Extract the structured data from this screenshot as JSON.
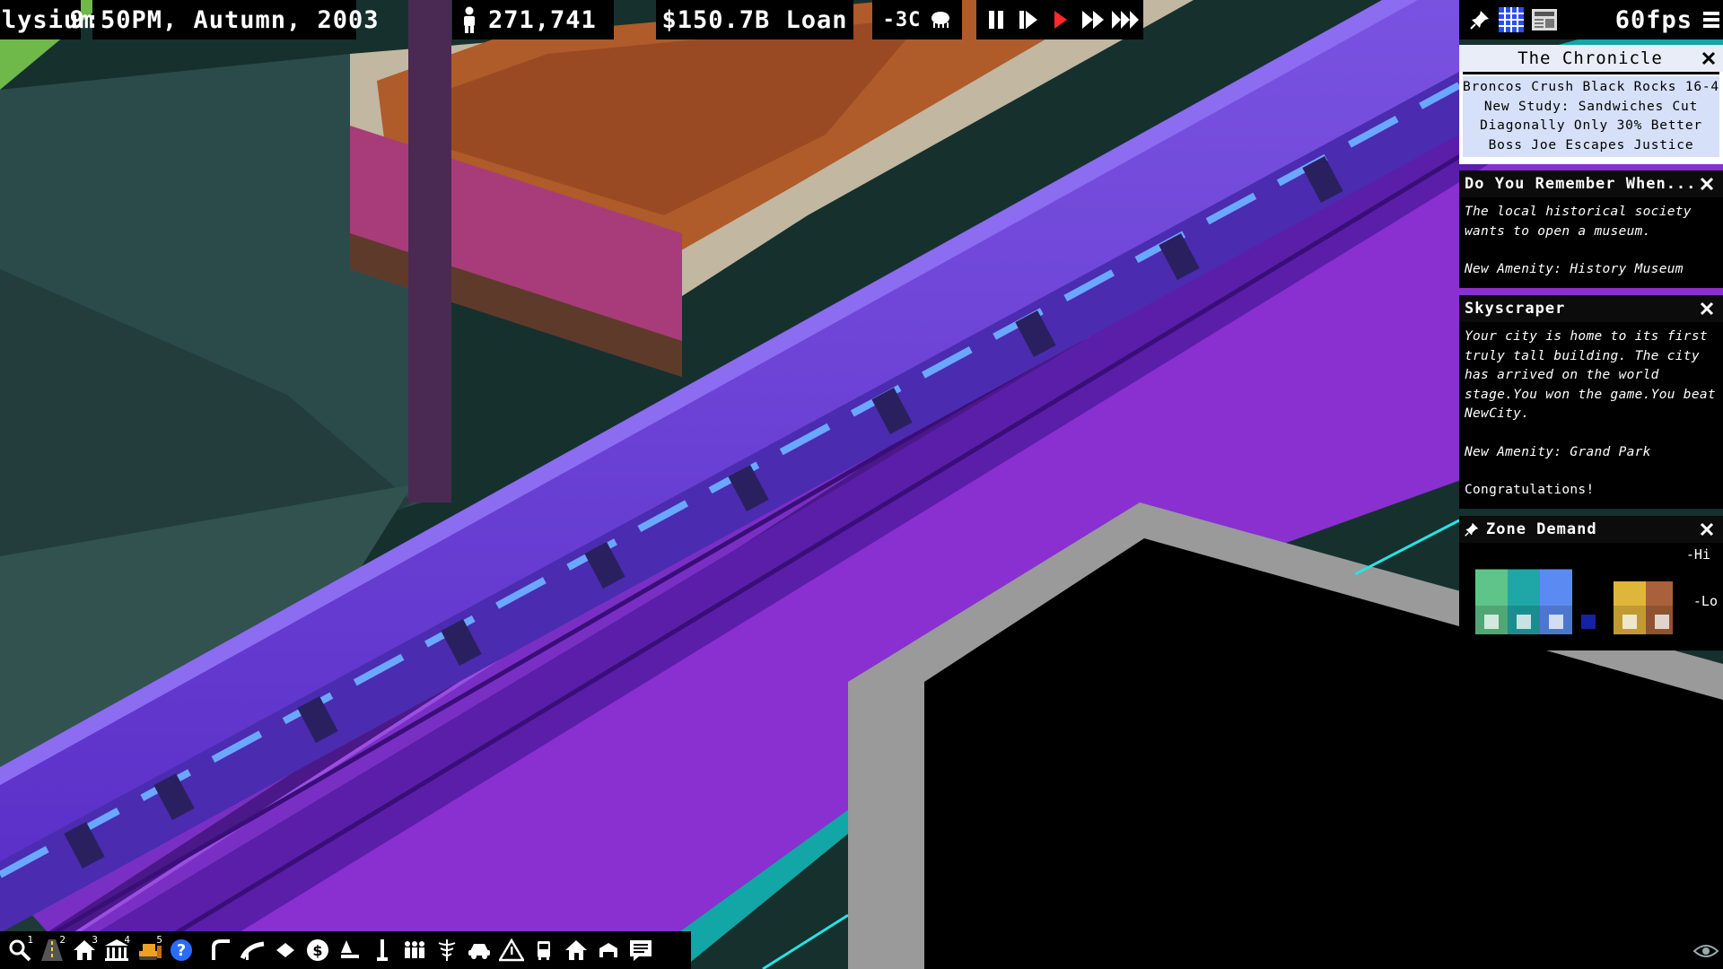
{
  "topbar": {
    "city_name": "Elysium",
    "datetime": "9:50PM, Autumn, 2003",
    "population": "271,741",
    "money": "$150.7B Loan",
    "temperature": "-3C",
    "fps": "60fps"
  },
  "panels": {
    "chronicle": {
      "title": "The Chronicle",
      "headlines": [
        "Broncos Crush Black Rocks 16-4",
        "New Study: Sandwiches Cut",
        "Diagonally Only 30% Better",
        "Boss Joe Escapes Justice"
      ]
    },
    "remember": {
      "title": "Do You Remember When...",
      "body": "The local historical society wants to open a museum.",
      "amenity": "New Amenity: History Museum"
    },
    "skyscraper": {
      "title": "Skyscraper",
      "body": "Your city is home to its first truly tall building. The city has arrived on the world stage.You won the game.You beat NewCity.",
      "amenity": "New Amenity: Grand Park",
      "footer": "Congratulations!"
    },
    "zone_demand": {
      "title": "Zone Demand",
      "hi_label": "-Hi",
      "lo_label": "-Lo",
      "bars": [
        {
          "zone": "residential",
          "level": 0.45,
          "color": "#5ec48a"
        },
        {
          "zone": "apartments",
          "level": 0.45,
          "color": "#1fa7a7"
        },
        {
          "zone": "retail",
          "level": 0.45,
          "color": "#5b8bf2"
        },
        {
          "zone": "office",
          "level": 0.0,
          "color": "#1c2fd8"
        },
        {
          "zone": "farm",
          "level": 0.3,
          "color": "#e0b63a"
        },
        {
          "zone": "industrial",
          "level": 0.3,
          "color": "#a8613a"
        }
      ]
    }
  },
  "toolbar": {
    "tools": [
      {
        "name": "query-tool",
        "hotkey": "1",
        "icon": "magnifier-icon"
      },
      {
        "name": "roads-tool",
        "hotkey": "2",
        "icon": "road-icon"
      },
      {
        "name": "zones-tool",
        "hotkey": "3",
        "icon": "house-icon"
      },
      {
        "name": "government-tool",
        "hotkey": "4",
        "icon": "government-building-icon"
      },
      {
        "name": "bulldozer-tool",
        "hotkey": "5",
        "icon": "bulldozer-icon"
      },
      {
        "name": "help-tool",
        "hotkey": "",
        "icon": "question-icon"
      }
    ]
  }
}
